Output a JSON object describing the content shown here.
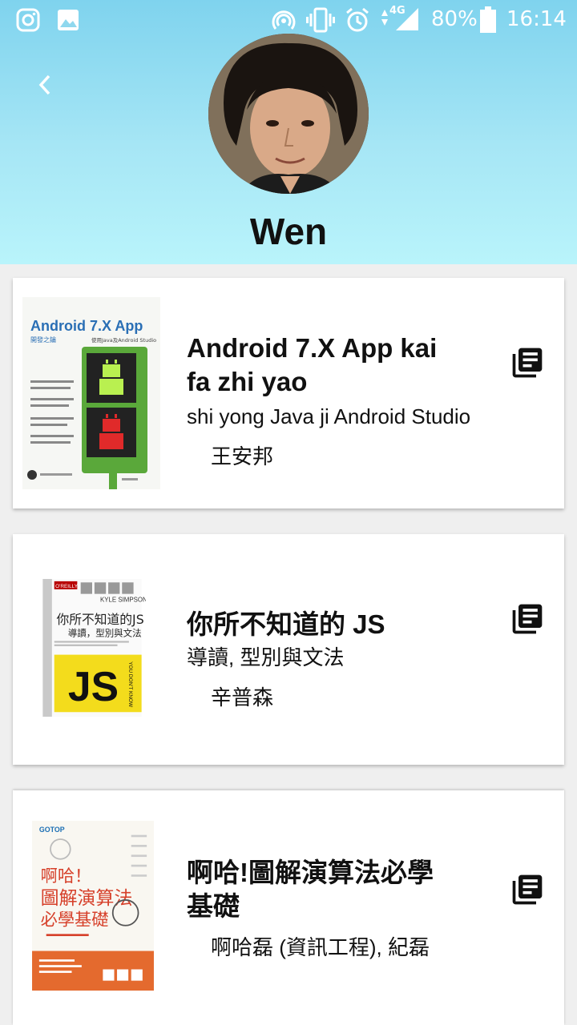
{
  "status_bar": {
    "battery": "80%",
    "time": "16:14",
    "network": "4G",
    "icons": [
      "instagram-icon",
      "gallery-icon",
      "hotspot-icon",
      "vibrate-icon",
      "alarm-icon",
      "signal-icon",
      "battery-icon"
    ]
  },
  "header": {
    "back_icon": "chevron-left-icon",
    "user_name": "Wen",
    "gradient_top": "#7fd3ee",
    "gradient_bottom": "#b9f4fb"
  },
  "books": [
    {
      "title": "Android 7.X App kai fa zhi yao",
      "subtitle": "shi yong Java ji Android Studio",
      "author": "王安邦",
      "cover": {
        "heading": "Android 7.X App",
        "line2": "開發之鑰",
        "line3": "使用Java及Android Studio"
      },
      "action_icon": "library-books-icon"
    },
    {
      "title": "你所不知道的 JS",
      "subtitle": "導讀, 型別與文法",
      "author": "辛普森",
      "cover": {
        "publisher": "O'REILLY",
        "author": "KYLE SIMPSON",
        "title": "你所不知道的JS",
        "subtitle": "導讀，型別與文法",
        "badge": "JS",
        "side": "YOU DON'T KNOW"
      },
      "action_icon": "library-books-icon"
    },
    {
      "title": "啊哈!圖解演算法必學基礎",
      "subtitle": "",
      "author": "啊哈磊 (資訊工程), 紀磊",
      "cover": {
        "publisher": "GOTOP",
        "line1": "啊哈！",
        "line2": "圖解演算法",
        "line3": "必學基礎"
      },
      "action_icon": "library-books-icon"
    }
  ]
}
